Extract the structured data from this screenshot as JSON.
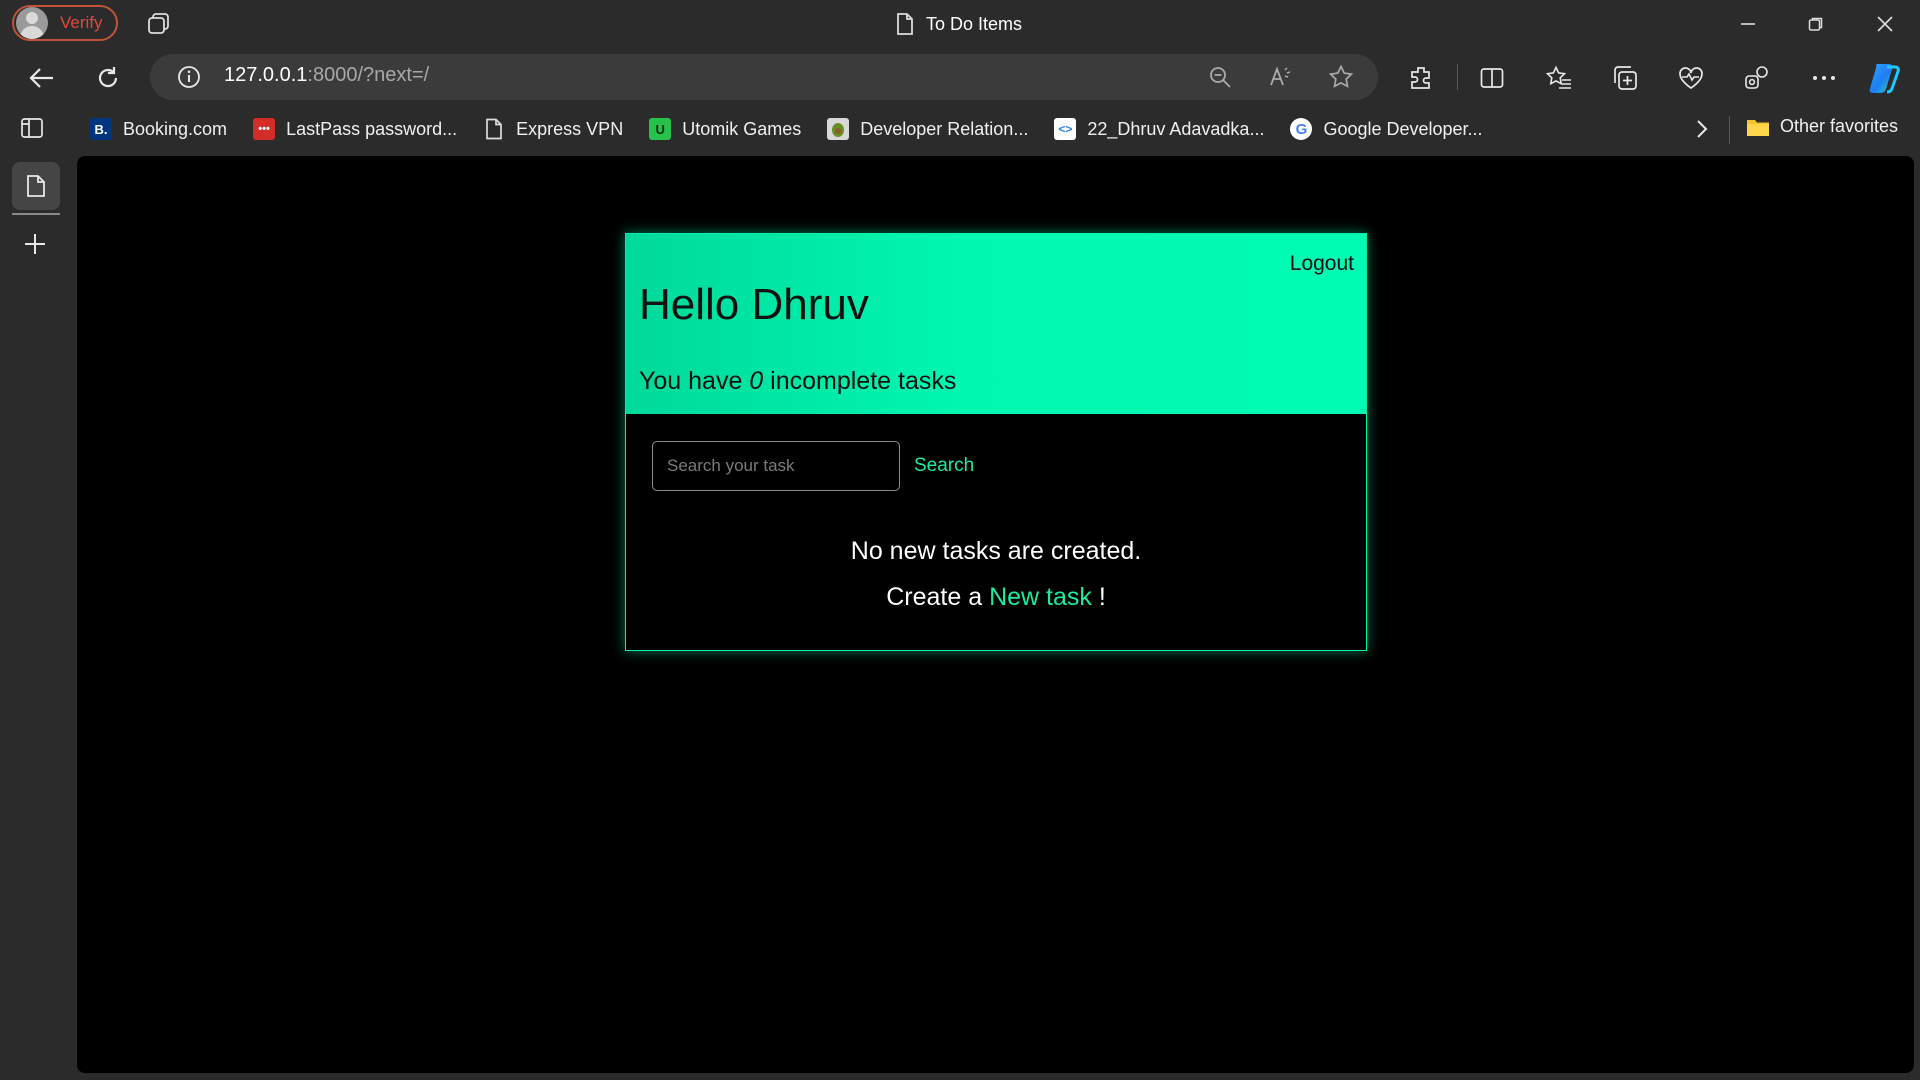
{
  "browser": {
    "profile_label": "Verify",
    "tab_title": "To Do Items",
    "url_host": "127.0.0.1",
    "url_rest": ":8000/?next=/",
    "favorites": [
      {
        "label": "Booking.com",
        "icon": "booking-icon",
        "color": "#003580",
        "glyph": "B."
      },
      {
        "label": "LastPass password...",
        "icon": "lastpass-icon",
        "color": "#d32d27",
        "glyph": "•••"
      },
      {
        "label": "Express VPN",
        "icon": "page-icon",
        "color": "#2b2b2b",
        "glyph": ""
      },
      {
        "label": "Utomik Games",
        "icon": "utomik-icon",
        "color": "#27c24c",
        "glyph": "U"
      },
      {
        "label": "Developer Relation...",
        "icon": "developer-relations-icon",
        "color": "#e0e0e0",
        "glyph": "🥑"
      },
      {
        "label": "22_Dhruv Adavadka...",
        "icon": "code-icon",
        "color": "#ffffff",
        "glyph": "<>"
      },
      {
        "label": "Google Developer...",
        "icon": "google-icon",
        "color": "#ffffff",
        "glyph": "G"
      }
    ],
    "other_favorites": "Other favorites"
  },
  "app": {
    "logout": "Logout",
    "greeting": "Hello Dhruv",
    "count_prefix": "You have ",
    "count": "0",
    "count_suffix": " incomplete tasks",
    "search_placeholder": "Search your task",
    "search_button": "Search",
    "empty_message": "No new tasks are created.",
    "create_prefix": "Create a ",
    "create_link": "New task",
    "create_suffix": " !"
  },
  "colors": {
    "accent": "#00f7b0",
    "link": "#1de9a0",
    "background": "#000000"
  }
}
